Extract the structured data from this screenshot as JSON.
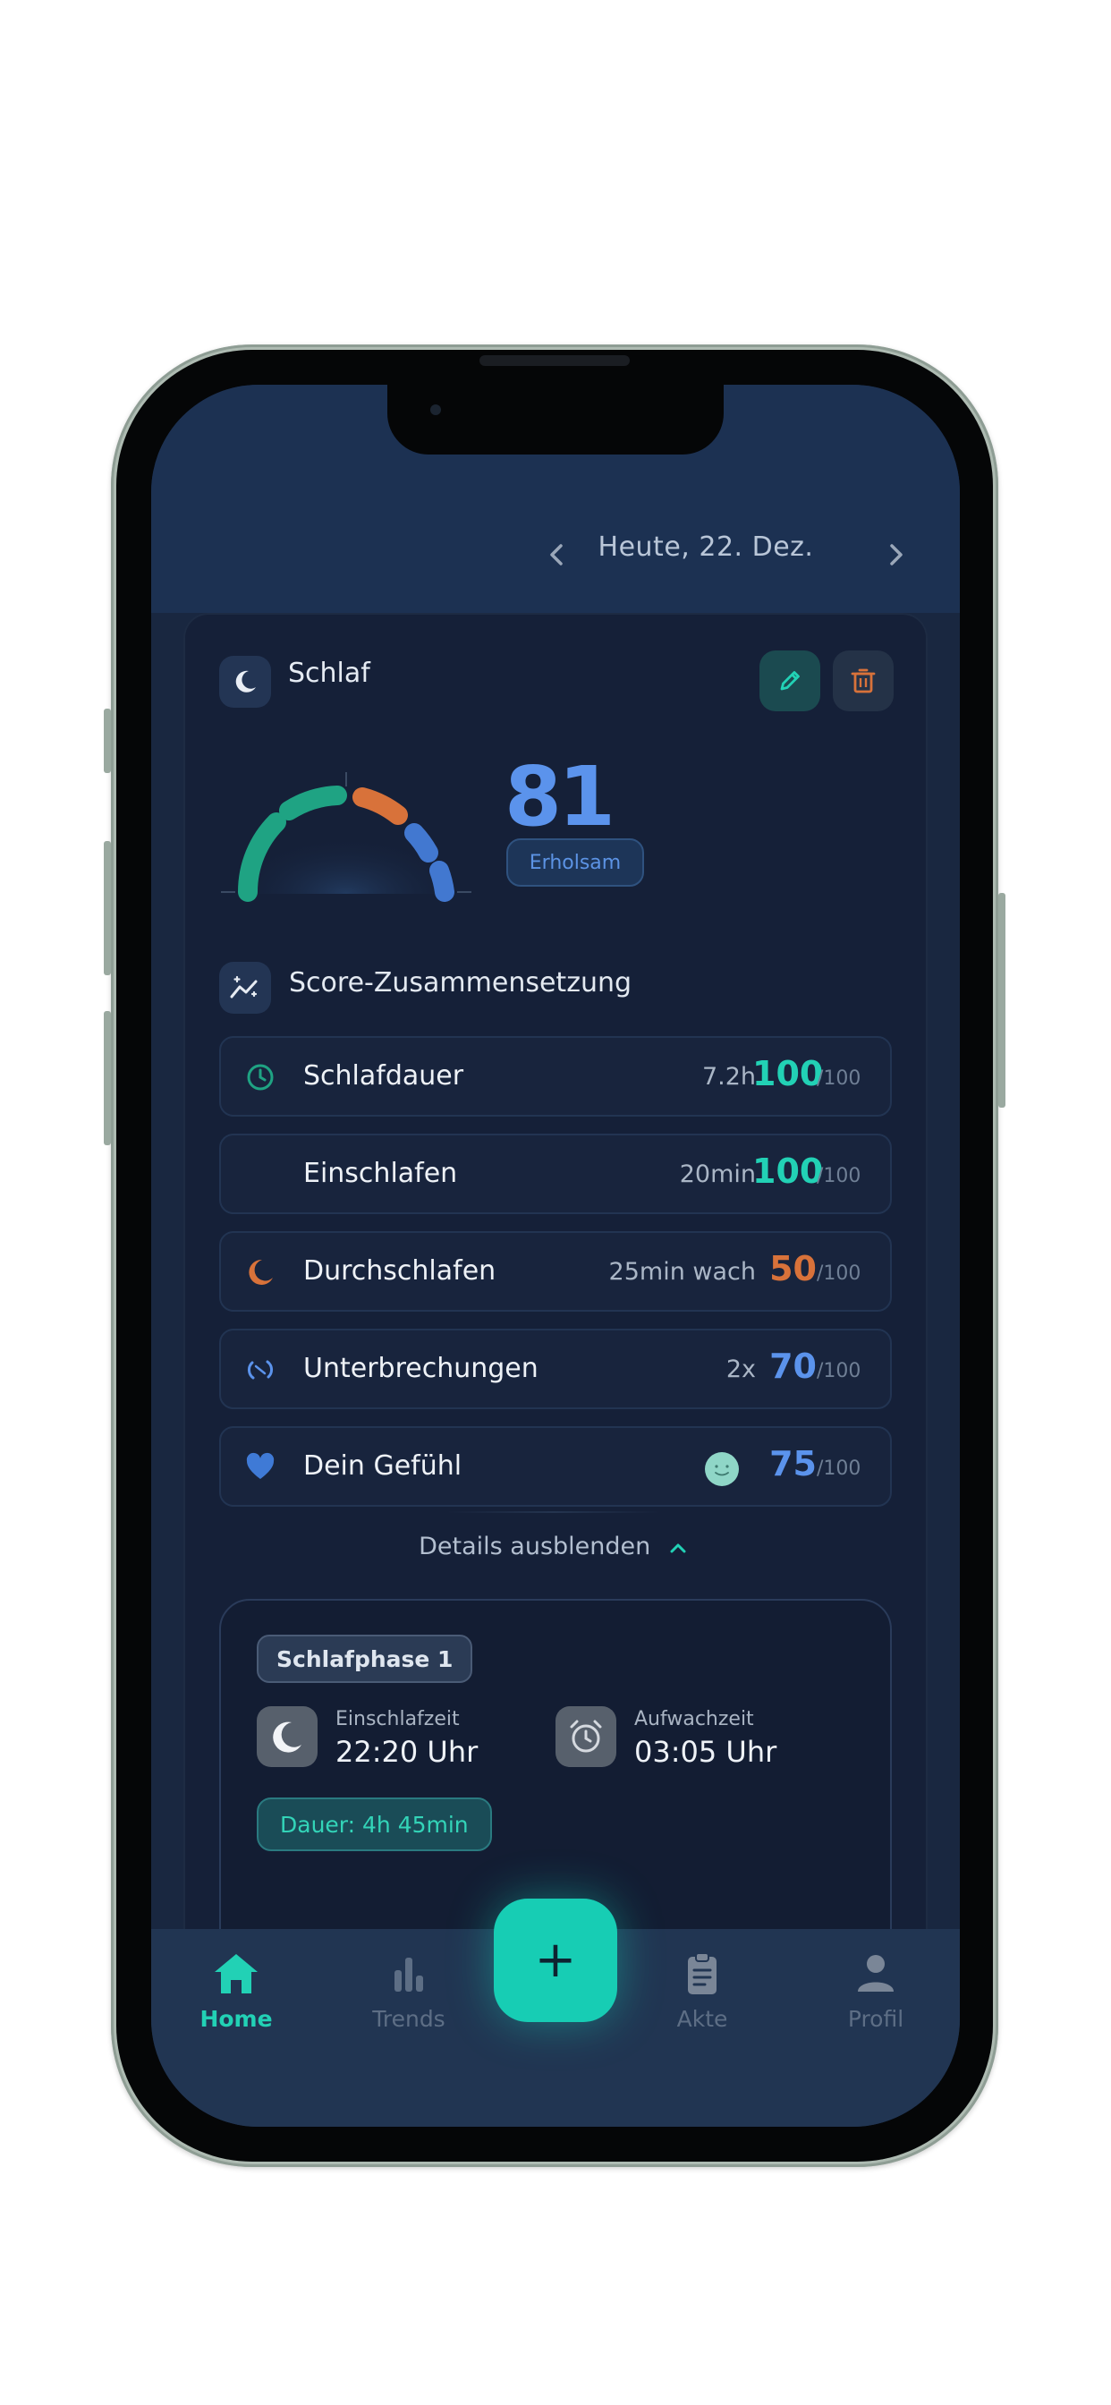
{
  "header": {
    "date": "Heute, 22. Dez."
  },
  "card": {
    "title": "Schlaf",
    "score": "81",
    "score_label": "Erholsam",
    "section_title": "Score-Zusammensetzung",
    "rows": [
      {
        "icon": "clock-icon",
        "label": "Schlafdauer",
        "value": "7.2h",
        "score": "100",
        "max": "/100",
        "color": "#22d1b5"
      },
      {
        "icon": "crescent-moon-icon",
        "label": "Einschlafen",
        "value": "20min",
        "score": "100",
        "max": "/100",
        "color": "#22d1b5"
      },
      {
        "icon": "moon-icon",
        "label": "Durchschlafen",
        "value": "25min wach",
        "score": "50",
        "max": "/100",
        "color": "#d8723a"
      },
      {
        "icon": "refresh-icon",
        "label": "Unterbrechungen",
        "value": "2x",
        "score": "70",
        "max": "/100",
        "color": "#5b93ec"
      },
      {
        "icon": "heart-icon",
        "label": "Dein Gefühl",
        "value": "",
        "score": "75",
        "max": "/100",
        "color": "#5b93ec"
      }
    ],
    "details_toggle": "Details ausblenden",
    "phase": {
      "tag": "Schlafphase 1",
      "sleep_label": "Einschlafzeit",
      "sleep_time": "22:20 Uhr",
      "wake_label": "Aufwachzeit",
      "wake_time": "03:05 Uhr",
      "duration": "Dauer: 4h 45min"
    }
  },
  "nav": {
    "tabs": [
      {
        "label": "Home",
        "icon": "home-icon",
        "active": true
      },
      {
        "label": "Trends",
        "icon": "bar-chart-icon",
        "active": false
      },
      {
        "label": "Akte",
        "icon": "clipboard-icon",
        "active": false
      },
      {
        "label": "Profil",
        "icon": "person-icon",
        "active": false
      }
    ],
    "fab": "+"
  },
  "colors": {
    "accent": "#17cdb4",
    "score_blue": "#5b93ec",
    "warning_orange": "#d8723a",
    "background": "#152038"
  }
}
